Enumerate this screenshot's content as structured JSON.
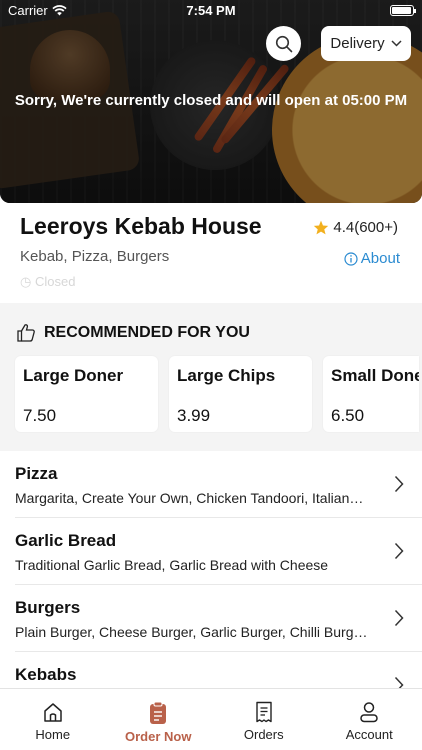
{
  "status_bar": {
    "carrier": "Carrier",
    "time": "7:54 PM"
  },
  "hero": {
    "closed_message": "Sorry, We're currently closed and will open at 05:00 PM"
  },
  "header": {
    "delivery_label": "Delivery"
  },
  "restaurant": {
    "name": "Leeroys Kebab House",
    "rating": "4.4(600+)",
    "cuisines": "Kebab, Pizza, Burgers",
    "about_label": "About",
    "status": "Closed"
  },
  "recommended": {
    "title": "RECOMMENDED FOR YOU",
    "items": [
      {
        "name": "Large Doner",
        "price": "7.50"
      },
      {
        "name": "Large Chips",
        "price": "3.99"
      },
      {
        "name": "Small Doner",
        "price": "6.50"
      }
    ]
  },
  "categories": [
    {
      "title": "Pizza",
      "desc": "Margarita, Create Your Own, Chicken Tandoori, Italian…"
    },
    {
      "title": "Garlic Bread",
      "desc": "Traditional Garlic Bread, Garlic Bread with Cheese"
    },
    {
      "title": "Burgers",
      "desc": "Plain Burger, Cheese Burger, Garlic Burger, Chilli Burg…"
    },
    {
      "title": "Kebabs",
      "desc": ""
    }
  ],
  "tabs": [
    {
      "label": "Home",
      "icon": "home-icon"
    },
    {
      "label": "Order Now",
      "icon": "order-icon"
    },
    {
      "label": "Orders",
      "icon": "receipt-icon"
    },
    {
      "label": "Account",
      "icon": "account-icon"
    }
  ],
  "colors": {
    "accent": "#b9614a",
    "link": "#2b8bd1",
    "star": "#f2b01e"
  }
}
